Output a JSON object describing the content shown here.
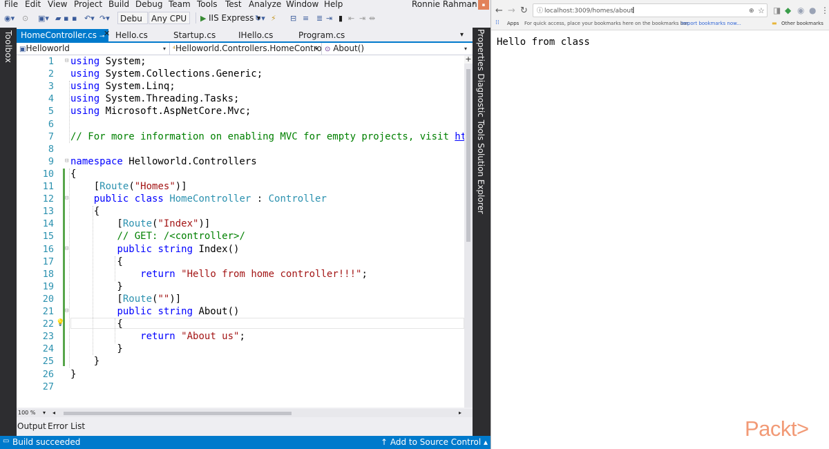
{
  "vs": {
    "menu": [
      "File",
      "Edit",
      "View",
      "Project",
      "Build",
      "Debug",
      "Team",
      "Tools",
      "Test",
      "Analyze",
      "Window",
      "Help"
    ],
    "user": "Ronnie Rahman",
    "toolbar": {
      "config": "Debu",
      "platform": "Any CPU",
      "run_target": "IIS Express"
    },
    "toolbox_label": "Toolbox",
    "tabs": [
      {
        "label": "HomeController.cs",
        "active": true
      },
      {
        "label": "Hello.cs",
        "active": false
      },
      {
        "label": "Startup.cs",
        "active": false
      },
      {
        "label": "IHello.cs",
        "active": false
      },
      {
        "label": "Program.cs",
        "active": false
      }
    ],
    "nav": {
      "project": "Helloworld",
      "type": "Helloworld.Controllers.HomeControll·",
      "member": "About()"
    },
    "code_lines": [
      {
        "n": "1",
        "html": "<span style=\"color:#0000ff\">using</span> System;"
      },
      {
        "n": "2",
        "html": "<span style=\"color:#0000ff\">using</span> System.Collections.Generic;"
      },
      {
        "n": "3",
        "html": "<span style=\"color:#0000ff\">using</span> System.Linq;"
      },
      {
        "n": "4",
        "html": "<span style=\"color:#0000ff\">using</span> System.Threading.Tasks;"
      },
      {
        "n": "5",
        "html": "<span style=\"color:#0000ff\">using</span> Microsoft.AspNetCore.Mvc;"
      },
      {
        "n": "6",
        "html": ""
      },
      {
        "n": "7",
        "html": "<span style=\"color:#008000\">// For more information on enabling MVC for empty projects, visit <u style=\"color:#0000ff\">https</u></span>"
      },
      {
        "n": "8",
        "html": ""
      },
      {
        "n": "9",
        "html": "<span style=\"color:#0000ff\">namespace</span> Helloworld.Controllers"
      },
      {
        "n": "10",
        "html": "{"
      },
      {
        "n": "11",
        "html": "    [<span style=\"color:#2b91af\">Route</span>(<span style=\"color:#a31515\">\"Homes\"</span>)]"
      },
      {
        "n": "12",
        "html": "    <span style=\"color:#0000ff\">public class</span> <span style=\"color:#2b91af\">HomeController</span> : <span style=\"color:#2b91af\">Controller</span>"
      },
      {
        "n": "13",
        "html": "    {"
      },
      {
        "n": "14",
        "html": "        [<span style=\"color:#2b91af\">Route</span>(<span style=\"color:#a31515\">\"Index\"</span>)]"
      },
      {
        "n": "15",
        "html": "        <span style=\"color:#008000\">// GET: /&lt;controller&gt;/</span>"
      },
      {
        "n": "16",
        "html": "        <span style=\"color:#0000ff\">public string</span> Index()"
      },
      {
        "n": "17",
        "html": "        {"
      },
      {
        "n": "18",
        "html": "            <span style=\"color:#0000ff\">return</span> <span style=\"color:#a31515\">\"Hello from home controller!!!\"</span>;"
      },
      {
        "n": "19",
        "html": "        }"
      },
      {
        "n": "20",
        "html": "        [<span style=\"color:#2b91af\">Route</span>(<span style=\"color:#a31515\">\"\"</span>)]"
      },
      {
        "n": "21",
        "html": "        <span style=\"color:#0000ff\">public string</span> About()"
      },
      {
        "n": "22",
        "html": "        {"
      },
      {
        "n": "23",
        "html": "            <span style=\"color:#0000ff\">return</span> <span style=\"color:#a31515\">\"About us\"</span>;"
      },
      {
        "n": "24",
        "html": "        }"
      },
      {
        "n": "25",
        "html": "    }"
      },
      {
        "n": "26",
        "html": "}"
      },
      {
        "n": "27",
        "html": ""
      }
    ],
    "zoom": "100 %",
    "output_tabs": [
      "Output",
      "Error List"
    ],
    "side_panels": "Properties  Diagnostic Tools  Solution Explorer",
    "status_left": "Build succeeded",
    "status_right": "↑ Add to Source Control ▴"
  },
  "browser": {
    "url": "localhost:3009/homes/about",
    "bookmarks": {
      "apps": "Apps",
      "hint": "For quick access, place your bookmarks here on the bookmarks bar.",
      "import_link": "Import bookmarks now...",
      "other": "Other bookmarks"
    },
    "page_text": "Hello from class"
  },
  "watermark": "Packt>"
}
